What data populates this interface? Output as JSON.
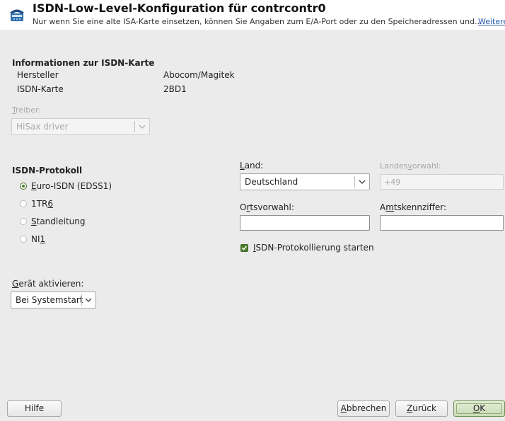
{
  "header": {
    "title": "ISDN-Low-Level-Konfiguration für contrcontr0",
    "subtitle": "Nur wenn Sie eine alte ISA-Karte einsetzen, können Sie Angaben zum E/A-Port oder zu den Speicheradressen und...",
    "more_link": "Weitere"
  },
  "card_info": {
    "heading": "Informationen zur ISDN-Karte",
    "rows": [
      {
        "label": "Hersteller",
        "value": "Abocom/Magitek"
      },
      {
        "label": "ISDN-Karte",
        "value": "2BD1"
      }
    ]
  },
  "driver": {
    "label_first": "T",
    "label_rest": "reiber:",
    "value": "HiSax driver",
    "enabled": false
  },
  "protocol": {
    "heading": "ISDN-Protokoll",
    "options": [
      {
        "pre": "",
        "key": "E",
        "post": "uro-ISDN (EDSS1)",
        "selected": true
      },
      {
        "pre": "1TR",
        "key": "6",
        "post": "",
        "selected": false
      },
      {
        "pre": "",
        "key": "S",
        "post": "tandleitung",
        "selected": false
      },
      {
        "pre": "NI",
        "key": "1",
        "post": "",
        "selected": false
      }
    ]
  },
  "country": {
    "label_key": "L",
    "label_rest": "and:",
    "value": "Deutschland"
  },
  "area_code": {
    "label_pre": "Landes",
    "label_key": "v",
    "label_post": "orwahl:",
    "value": "+49",
    "enabled": false
  },
  "local_code": {
    "label_pre": "O",
    "label_key": "r",
    "label_post": "tsvorwahl:",
    "value": ""
  },
  "outside_line": {
    "label_pre": "A",
    "label_key": "m",
    "label_post": "tskennziffer:",
    "value": ""
  },
  "logging": {
    "label_key": "I",
    "label_rest": "SDN-Protokollierung starten",
    "checked": true
  },
  "activation": {
    "label_key": "G",
    "label_rest": "erät aktivieren:",
    "value": "Bei Systemstart"
  },
  "buttons": {
    "help": "Hilfe",
    "cancel_key": "A",
    "cancel_rest": "bbrechen",
    "back_key": "Z",
    "back_rest": "urück",
    "ok_key": "O",
    "ok_rest": "K"
  },
  "colors": {
    "accent_green": "#4a7c2a",
    "link_blue": "#2a5db0",
    "background": "#ebebeb"
  },
  "icons": {
    "app": "phone-network-icon",
    "dropdown": "chevron-down-icon",
    "check": "checkmark-icon"
  }
}
